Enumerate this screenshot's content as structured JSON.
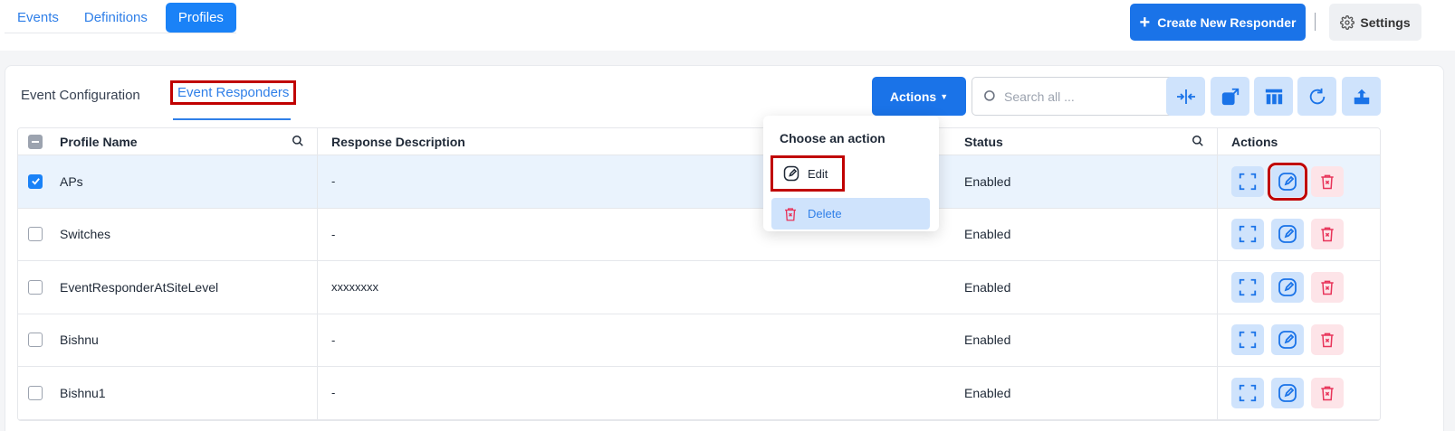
{
  "nav": {
    "tabs": [
      {
        "label": "Events"
      },
      {
        "label": "Definitions"
      },
      {
        "label": "Profiles",
        "active": true
      }
    ],
    "create_label": "Create New Responder",
    "settings_label": "Settings"
  },
  "subtabs": {
    "config": "Event Configuration",
    "responders": "Event Responders"
  },
  "toolbar": {
    "actions_label": "Actions",
    "search_placeholder": "Search all ...",
    "tools": [
      "collapse-columns-icon",
      "export-icon",
      "column-layout-icon",
      "refresh-icon",
      "upload-icon"
    ]
  },
  "table": {
    "columns": [
      "Profile Name",
      "Response Description",
      "Status",
      "Actions"
    ],
    "rows": [
      {
        "name": "APs",
        "description": "-",
        "status": "Enabled",
        "selected": true
      },
      {
        "name": "Switches",
        "description": "-",
        "status": "Enabled"
      },
      {
        "name": "EventResponderAtSiteLevel",
        "description": "xxxxxxxx",
        "status": "Enabled"
      },
      {
        "name": "Bishnu",
        "description": "-",
        "status": "Enabled"
      },
      {
        "name": "Bishnu1",
        "description": "-",
        "status": "Enabled"
      }
    ]
  },
  "dropdown": {
    "title": "Choose an action",
    "edit_label": "Edit",
    "delete_label": "Delete"
  },
  "colors": {
    "primary": "#1a73e8",
    "accent_light": "#cfe3fc",
    "danger": "#e8345a",
    "highlight": "#c00000"
  }
}
